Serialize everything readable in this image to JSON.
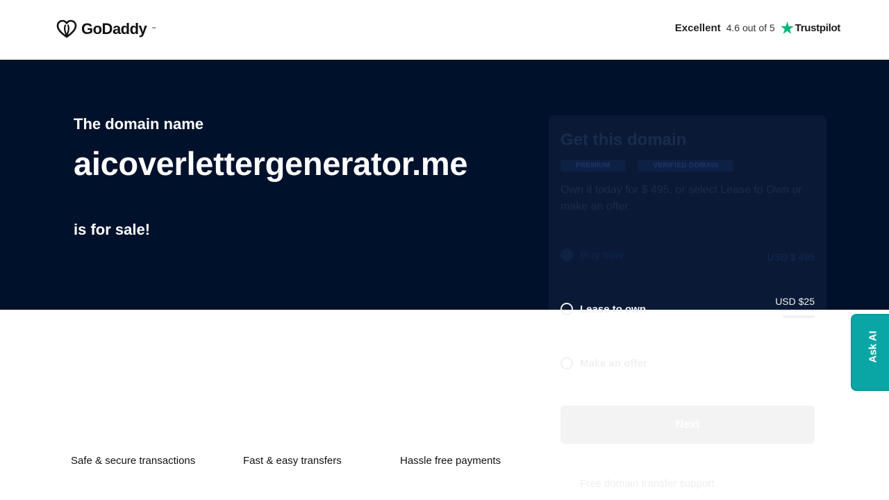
{
  "header": {
    "brand": "GoDaddy",
    "rating_label": "Excellent",
    "rating_score": "4.6 out of 5",
    "review_brand": "Trustpilot"
  },
  "hero": {
    "intro": "The domain name",
    "domain": "aicoverlettergenerator.me",
    "suffix": "is for sale!"
  },
  "card": {
    "title": "Get this domain",
    "badges": [
      "PREMIUM",
      "VERIFIED DOMAIN"
    ],
    "description": "Own it today for $ 495, or select Lease to Own or make an offer.",
    "options": {
      "buy_label": "Buy now",
      "buy_price": "USD $ 495",
      "lease_label": "Lease to own",
      "lease_price": "USD $25",
      "offer_label": "Make an offer"
    },
    "next_label": "Next",
    "support_text": "Free domain transfer support"
  },
  "features": [
    "Safe & secure transactions",
    "Fast & easy transfers",
    "Hassle free payments"
  ],
  "ask_ai": "Ask AI",
  "colors": {
    "hero_bg": "#00112c",
    "accent_teal": "#0aa6a6",
    "trustpilot_green": "#00b67a"
  }
}
